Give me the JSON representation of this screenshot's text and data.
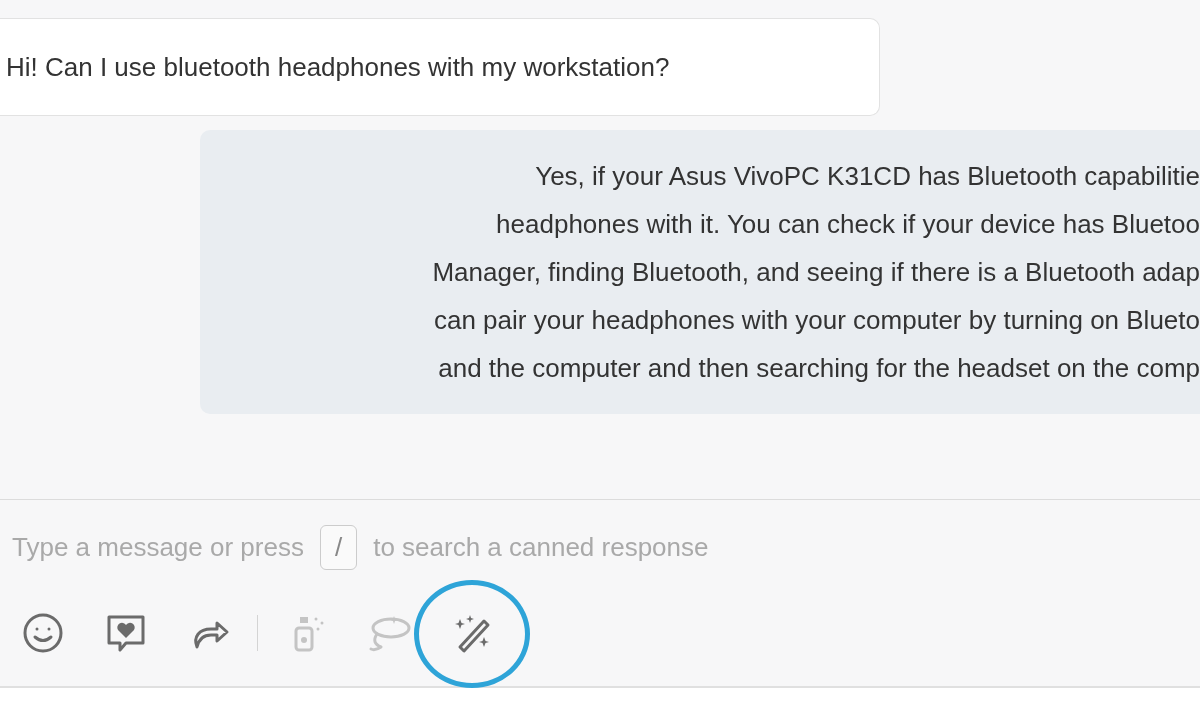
{
  "conversation": {
    "messages": [
      {
        "kind": "customer",
        "lines": [
          "Hi! Can I use bluetooth headphones with my workstation?"
        ]
      },
      {
        "kind": "agent",
        "lines": [
          "Yes, if your Asus VivoPC K31CD has Bluetooth capabilitie",
          "headphones with it. You can check if your device has Bluetoo",
          "Manager, finding Bluetooth, and seeing if there is a Bluetooth adap",
          "can pair your headphones with your computer by turning on Blueto",
          "and the computer and then searching for the headset on the comp"
        ]
      }
    ]
  },
  "composer": {
    "placeholder_start": "Type a message or press",
    "shortcut_key": "/",
    "placeholder_end": "to search a canned response"
  },
  "toolbar": [
    {
      "kind": "emoji",
      "disabled": false,
      "highlighted": false
    },
    {
      "kind": "feedback",
      "disabled": false,
      "highlighted": false
    },
    {
      "kind": "forward",
      "disabled": false,
      "highlighted": false
    },
    {
      "kind": "separator"
    },
    {
      "kind": "bottle",
      "disabled": true,
      "highlighted": false
    },
    {
      "kind": "lasso",
      "disabled": true,
      "highlighted": false
    },
    {
      "kind": "wand",
      "disabled": false,
      "highlighted": true
    }
  ]
}
